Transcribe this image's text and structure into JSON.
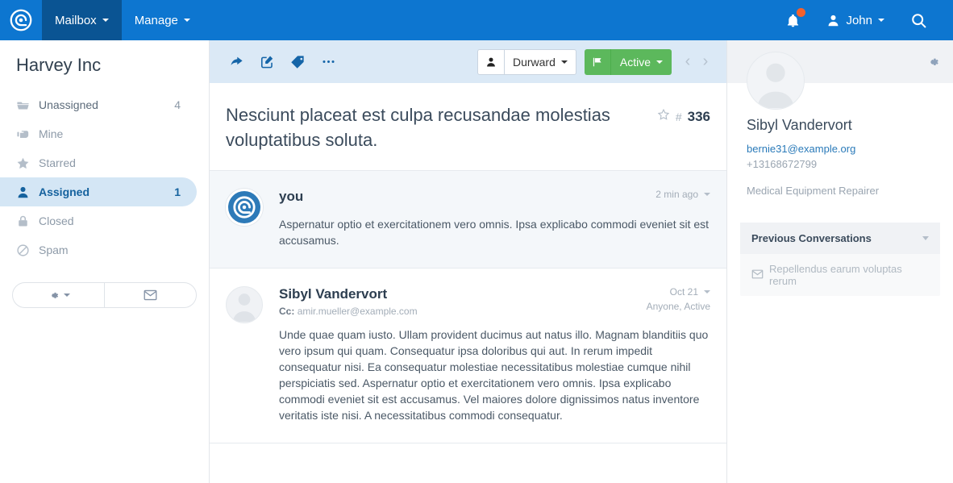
{
  "topnav": {
    "brand_icon": "spiral-logo-icon",
    "items": [
      {
        "label": "Mailbox",
        "active": true
      },
      {
        "label": "Manage",
        "active": false
      }
    ],
    "notifications_icon": "bell-icon",
    "user_name": "John",
    "user_icon": "person-icon",
    "search_icon": "search-icon"
  },
  "sidebar": {
    "title": "Harvey Inc",
    "items": [
      {
        "label": "Unassigned",
        "count": "4",
        "icon": "folder-icon",
        "active": false
      },
      {
        "label": "Mine",
        "count": "",
        "icon": "hand-pointer-icon",
        "active": false
      },
      {
        "label": "Starred",
        "count": "",
        "icon": "star-icon",
        "active": false
      },
      {
        "label": "Assigned",
        "count": "1",
        "icon": "person-icon",
        "active": true
      },
      {
        "label": "Closed",
        "count": "",
        "icon": "lock-icon",
        "active": false
      },
      {
        "label": "Spam",
        "count": "",
        "icon": "ban-icon",
        "active": false
      }
    ],
    "buttons": [
      {
        "icon": "gear-icon",
        "has_caret": true
      },
      {
        "icon": "envelope-icon",
        "has_caret": false
      }
    ]
  },
  "toolbar": {
    "icons": [
      "forward-arrow-icon",
      "compose-icon",
      "tag-icon",
      "ellipsis-icon"
    ],
    "assignee": {
      "icon": "person-icon",
      "label": "Durward"
    },
    "status": {
      "icon": "flag-icon",
      "label": "Active",
      "color": "#5cb85c"
    },
    "prev_label": "‹",
    "next_label": "›"
  },
  "conversation": {
    "subject": "Nesciunt placeat est culpa recusandae molestias voluptatibus soluta.",
    "star_icon": "star-outline-icon",
    "hash": "#",
    "number": "336",
    "messages": [
      {
        "from": "you",
        "avatar": "spiral-logo-avatar",
        "self": true,
        "cc": "",
        "cc_label": "",
        "time": "2 min ago",
        "status": "",
        "text": "Aspernatur optio et exercitationem vero omnis. Ipsa explicabo commodi eveniet sit est accusamus."
      },
      {
        "from": "Sibyl Vandervort",
        "avatar": "blank-person-avatar",
        "self": false,
        "cc_label": "Cc:",
        "cc": "amir.mueller@example.com",
        "time": "Oct 21",
        "status": "Anyone, Active",
        "text": "Unde quae quam iusto. Ullam provident ducimus aut natus illo. Magnam blanditiis quo vero ipsum qui quam. Consequatur ipsa doloribus qui aut. In rerum impedit consequatur nisi. Ea consequatur molestiae necessitatibus molestiae cumque nihil perspiciatis sed. Aspernatur optio et exercitationem vero omnis. Ipsa explicabo commodi eveniet sit est accusamus. Vel maiores dolore dignissimos natus inventore veritatis iste nisi. A necessitatibus commodi consequatur."
      }
    ]
  },
  "contact_panel": {
    "gear_icon": "gear-icon",
    "avatar": "blank-person-avatar",
    "name": "Sibyl Vandervort",
    "email": "bernie31@example.org",
    "phone": "+13168672799",
    "job_title": "Medical Equipment Repairer",
    "previous": {
      "heading": "Previous Conversations",
      "caret_icon": "chevron-down-icon",
      "items": [
        {
          "icon": "envelope-icon",
          "label": "Repellendus earum voluptas rerum"
        }
      ]
    }
  },
  "colors": {
    "brand_blue": "#0d76d0",
    "brand_blue_dark": "#0a5493",
    "toolbar_blue": "#dbe9f6",
    "active_item": "#d4e6f5",
    "green": "#5cb85c",
    "link": "#2a7ab9",
    "badge_orange": "#f4612c"
  }
}
